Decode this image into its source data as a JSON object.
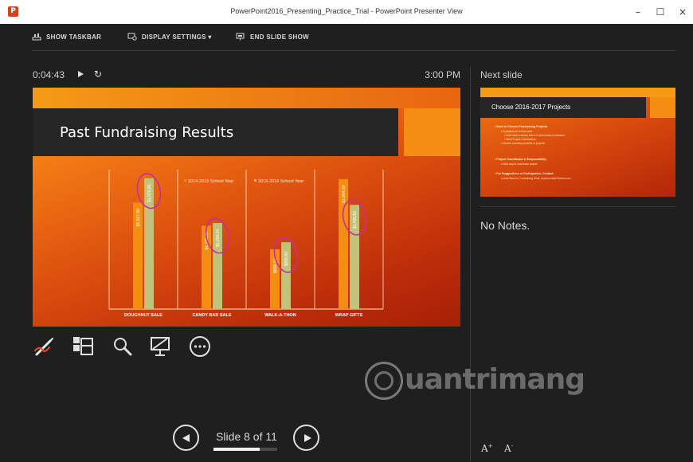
{
  "window": {
    "title": "PowerPoint2016_Presenting_Practice_Trial - PowerPoint Presenter View",
    "app_icon": "P",
    "minimize": "–",
    "maximize": "☐",
    "close": "×"
  },
  "toolbar": {
    "show_taskbar": "SHOW TASKBAR",
    "display_settings": "DISPLAY SETTINGS ▾",
    "end_slide_show": "END SLIDE SHOW"
  },
  "timer": {
    "elapsed": "0:04:43",
    "clock": "3:00 PM"
  },
  "current_slide": {
    "title": "Past Fundraising Results",
    "colors": {
      "accent": "#f58d12",
      "title_box": "#262626",
      "bar_2014": "#f58d12",
      "bar_2015": "#c2c27a",
      "ink": "#c4309a"
    }
  },
  "chart_data": {
    "type": "bar",
    "categories": [
      "DOUGHNUT SALE",
      "CANDY BAR SALE",
      "WALK-A-THON",
      "WRAP GIFTS"
    ],
    "series": [
      {
        "name": "2014-2015 School Year",
        "values": [
          1527.8,
          1195.3,
          858.0,
          1864.5
        ],
        "labels": [
          "$1,527.80",
          "$1,195.30",
          "$858.00",
          "$1,864.50"
        ]
      },
      {
        "name": "2015-2016 School Year",
        "values": [
          1876.8,
          1234.2,
          958.8,
          1495.5
        ],
        "labels": [
          "$1,876.80",
          "$1,234.20",
          "$958.80",
          "$1,495.50"
        ]
      }
    ],
    "legend_position": "top",
    "ink_circled_series": "2015-2016 School Year"
  },
  "tools": [
    {
      "name": "pen-laser-tool",
      "icon": "pen-icon"
    },
    {
      "name": "see-all-slides-tool",
      "icon": "grid-icon"
    },
    {
      "name": "zoom-tool",
      "icon": "magnifier-icon"
    },
    {
      "name": "black-screen-tool",
      "icon": "screen-icon"
    },
    {
      "name": "more-options-tool",
      "icon": "ellipsis-icon"
    }
  ],
  "next_slide": {
    "label": "Next slide",
    "title": "Choose 2016-2017 Projects",
    "bullets": [
      {
        "text": "• Need to Choose Fundraising Projects",
        "subs": [
          "o 3 projects per school year",
          "• Each lasts 6 weeks, with a 2-week break in between",
          "• Need Project Coordinators",
          "o Review monetary benefits of projects"
        ]
      },
      {
        "text": "• Project Coordinator's Responsibility:",
        "subs": [
          "o Best way to coordinate project"
        ]
      },
      {
        "text": "• For Suggestions or Participation, Contact:",
        "subs": [
          "o Julia Stevens, Fundraising Chair, at jstevens@CSchool.com"
        ]
      }
    ]
  },
  "notes": {
    "text": "No Notes."
  },
  "watermark": {
    "text": "uantrimang"
  },
  "navigation": {
    "slide_counter": "Slide 8 of 11",
    "current": 8,
    "total": 11,
    "progress": 0.73
  },
  "font_controls": {
    "increase": "A",
    "decrease": "A"
  }
}
